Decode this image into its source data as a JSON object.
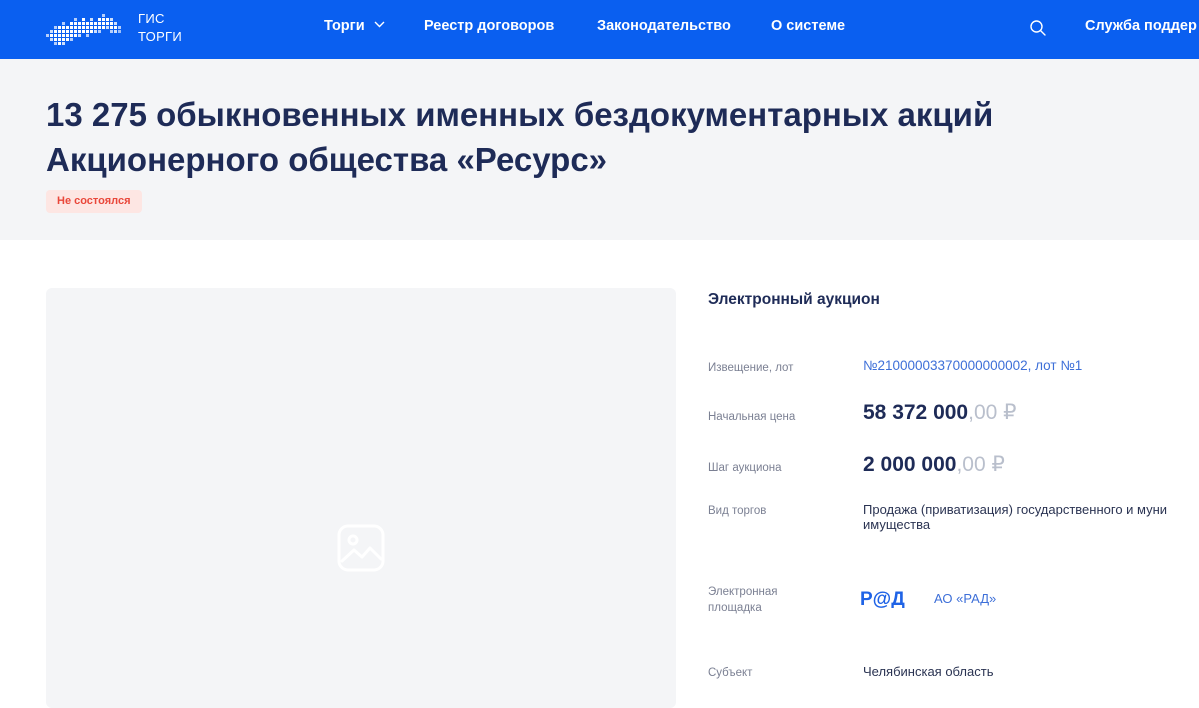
{
  "colors": {
    "header_bg": "#0a5ff0",
    "title_text": "#1e2b57",
    "band_bg": "#f4f5f7",
    "status_bg": "#fde6e3",
    "status_text": "#e9473a",
    "link": "#3d6fd8"
  },
  "header": {
    "logo": {
      "line1": "ГИС",
      "line2": "ТОРГИ",
      "icon": "russia-map-icon"
    },
    "nav": [
      {
        "label": "Торги",
        "has_dropdown": true
      },
      {
        "label": "Реестр договоров"
      },
      {
        "label": "Законодательство"
      },
      {
        "label": "О системе"
      }
    ],
    "search_icon": "search-icon",
    "support_label": "Служба поддер"
  },
  "lot": {
    "title": "13 275 обыкновенных именных бездокументарных акций Акционерного общества «Ресурс»",
    "status": "Не состоялся",
    "image_icon": "image-placeholder-icon"
  },
  "details": {
    "auction_type": "Электронный аукцион",
    "notice": {
      "label": "Извещение, лот",
      "value": "№21000003370000000002, лот №1"
    },
    "start_price": {
      "label": "Начальная цена",
      "main": "58 372 000",
      "cents": ",00 ₽"
    },
    "step": {
      "label": "Шаг аукциона",
      "main": "2 000 000",
      "cents": ",00 ₽"
    },
    "trade_kind": {
      "label": "Вид торгов",
      "value": "Продажа (приватизация) государственного и муни имущества"
    },
    "platform": {
      "label": "Электронная площадка",
      "logo_text": "Р@Д",
      "name": "АО «РАД»"
    },
    "subject": {
      "label": "Субъект",
      "value": "Челябинская область"
    }
  }
}
